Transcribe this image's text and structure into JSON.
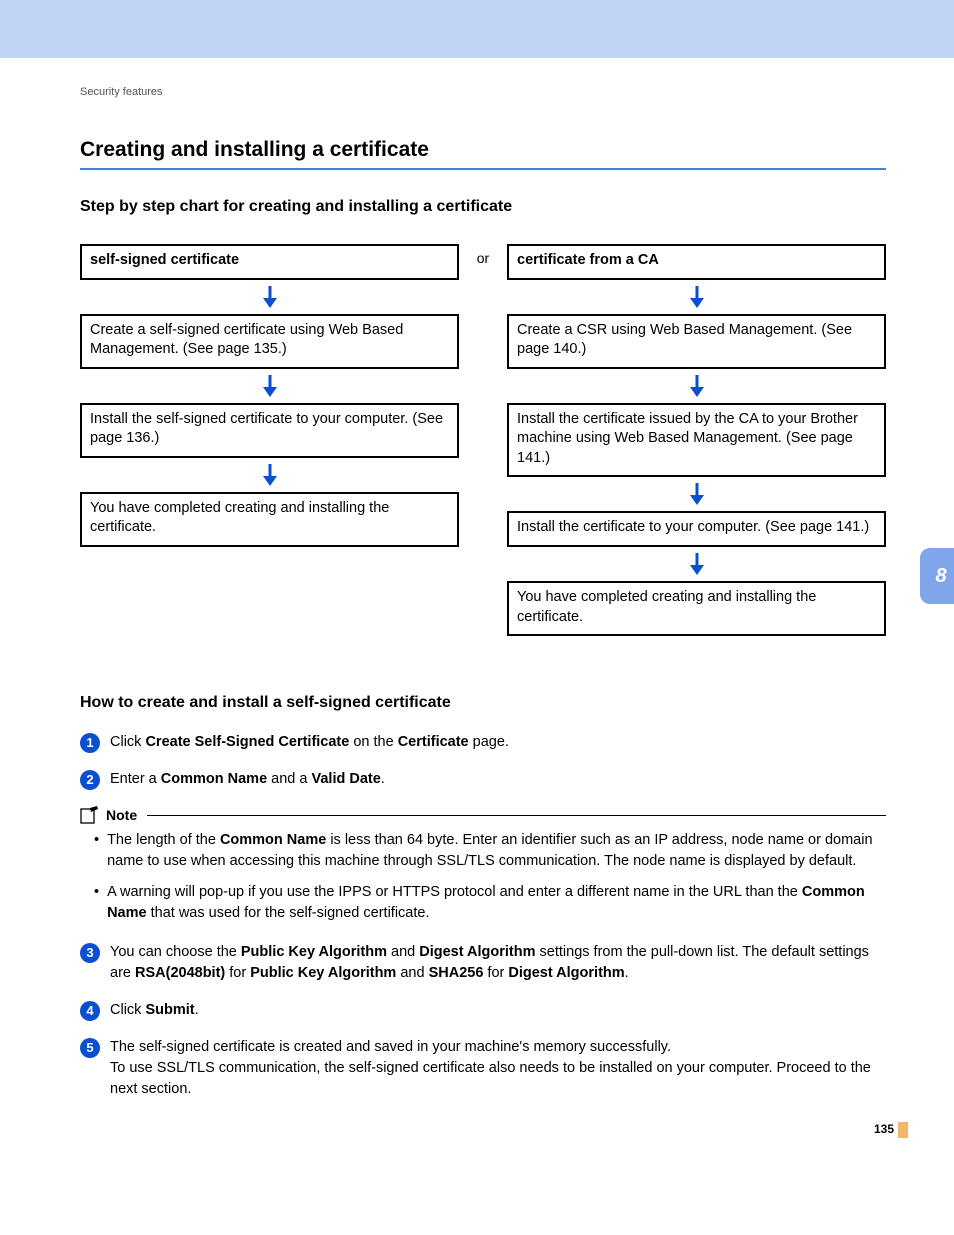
{
  "running_header": "Security features",
  "section_title": "Creating and installing a certificate",
  "chart_title": "Step by step chart for creating and installing a certificate",
  "or_label": "or",
  "flow_left": {
    "header": "self-signed certificate",
    "steps": [
      "Create a self-signed certificate using Web Based Management. (See page 135.)",
      "Install the self-signed certificate to your computer. (See page 136.)",
      "You have completed creating and installing the certificate."
    ]
  },
  "flow_right": {
    "header": "certificate from a CA",
    "steps": [
      "Create a CSR using Web Based Management. (See page 140.)",
      "Install the certificate issued by the CA to your Brother machine using Web Based Management. (See page 141.)",
      "Install the certificate to your computer. (See page 141.)",
      "You have completed creating and installing the certificate."
    ]
  },
  "howto_title": "How to create and install a self-signed certificate",
  "steps": {
    "s1": {
      "pre": "Click ",
      "b1": "Create Self-Signed Certificate",
      "mid": " on the ",
      "b2": "Certificate",
      "post": " page."
    },
    "s2": {
      "pre": "Enter a ",
      "b1": "Common Name",
      "mid": " and a ",
      "b2": "Valid Date",
      "post": "."
    },
    "s3": {
      "pre": "You can choose the ",
      "b1": "Public Key Algorithm",
      "mid1": " and ",
      "b2": "Digest Algorithm",
      "mid2": " settings from the pull-down list. The default settings are ",
      "b3": "RSA(2048bit)",
      "mid3": " for ",
      "b4": "Public Key Algorithm",
      "mid4": " and ",
      "b5": "SHA256",
      "mid5": " for ",
      "b6": "Digest Algorithm",
      "post": "."
    },
    "s4": {
      "pre": "Click ",
      "b1": "Submit",
      "post": "."
    },
    "s5_line1": "The self-signed certificate is created and saved in your machine's memory successfully.",
    "s5_line2": "To use SSL/TLS communication, the self-signed certificate also needs to be installed on your computer. Proceed to the next section."
  },
  "note": {
    "label": "Note",
    "items": {
      "i1": {
        "pre": "The length of the ",
        "b1": "Common Name",
        "post": " is less than 64 byte. Enter an identifier such as an IP address, node name or domain name to use when accessing this machine through SSL/TLS communication. The node name is displayed by default."
      },
      "i2": {
        "pre": "A warning will pop-up if you use the IPPS or HTTPS protocol and enter a different name in the URL than the ",
        "b1": "Common Name",
        "post": " that was used for the self-signed certificate."
      }
    }
  },
  "side_tab": "8",
  "page_number": "135"
}
